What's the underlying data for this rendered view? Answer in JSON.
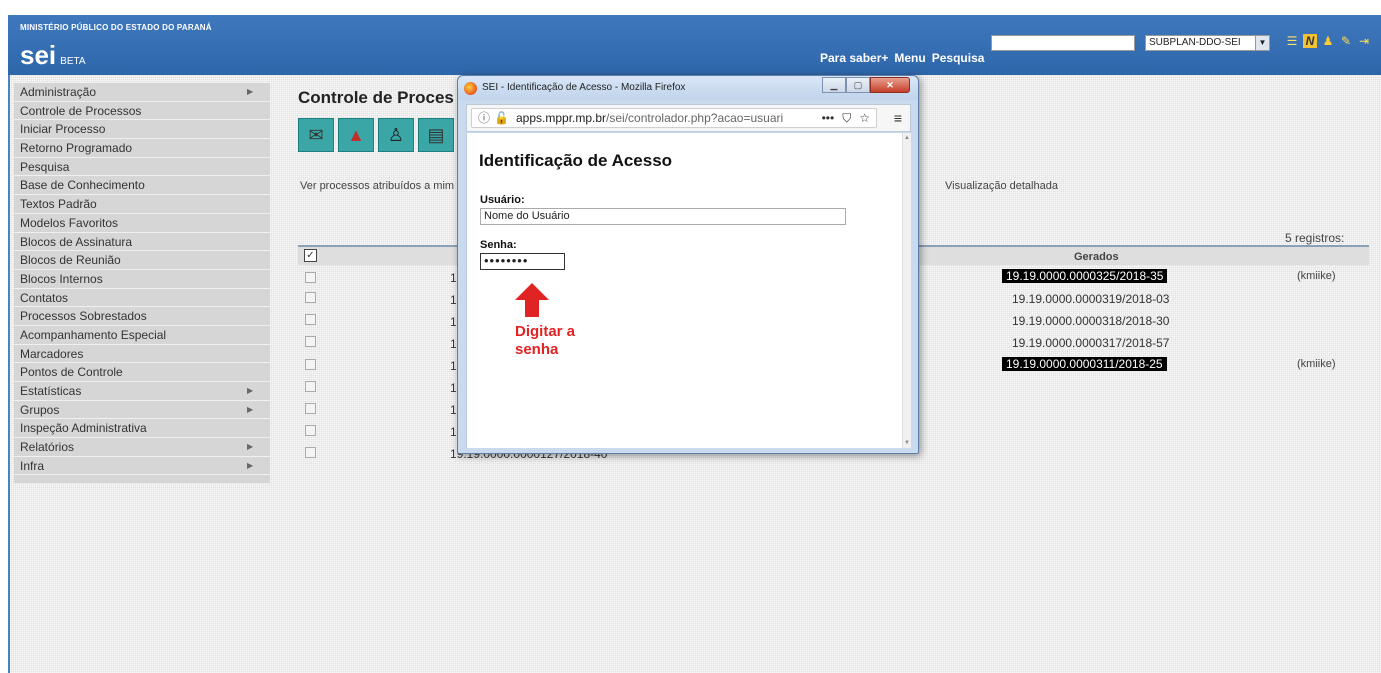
{
  "header": {
    "org_name": "MINISTÉRIO PÚBLICO DO ESTADO DO PARANÁ",
    "logo": "sei",
    "logo_beta": "BETA",
    "nav": [
      "Para saber+",
      "Menu",
      "Pesquisa"
    ],
    "search_value": "",
    "unit_selected": "SUBPLAN-DDO-SEI",
    "icons": [
      "list-icon",
      "n-icon",
      "user-icon",
      "wrench-icon",
      "exit-icon"
    ]
  },
  "sidebar": {
    "items": [
      {
        "label": "Administração",
        "submenu": true
      },
      {
        "label": "Controle de Processos",
        "submenu": false
      },
      {
        "label": "Iniciar Processo",
        "submenu": false
      },
      {
        "label": "Retorno Programado",
        "submenu": false
      },
      {
        "label": "Pesquisa",
        "submenu": false
      },
      {
        "label": "Base de Conhecimento",
        "submenu": false
      },
      {
        "label": "Textos Padrão",
        "submenu": false
      },
      {
        "label": "Modelos Favoritos",
        "submenu": false
      },
      {
        "label": "Blocos de Assinatura",
        "submenu": false
      },
      {
        "label": "Blocos de Reunião",
        "submenu": false
      },
      {
        "label": "Blocos Internos",
        "submenu": false
      },
      {
        "label": "Contatos",
        "submenu": false
      },
      {
        "label": "Processos Sobrestados",
        "submenu": false
      },
      {
        "label": "Acompanhamento Especial",
        "submenu": false
      },
      {
        "label": "Marcadores",
        "submenu": false
      },
      {
        "label": "Pontos de Controle",
        "submenu": false
      },
      {
        "label": "Estatísticas",
        "submenu": true
      },
      {
        "label": "Grupos",
        "submenu": true
      },
      {
        "label": "Inspeção Administrativa",
        "submenu": false
      },
      {
        "label": "Relatórios",
        "submenu": true
      },
      {
        "label": "Infra",
        "submenu": true
      }
    ]
  },
  "main": {
    "title": "Controle de Proces",
    "ver_link": "Ver processos atribuídos a mim",
    "detail_link": "Visualização detalhada",
    "registros": "5 registros:",
    "col_gerados": "Gerados",
    "row_fragment": "19",
    "last_row_partial": "19.19.0000.0000127/2018-40",
    "gerados": [
      {
        "number": "19.19.0000.0000325/2018-35",
        "highlighted": true,
        "user": "(kmiike)"
      },
      {
        "number": "19.19.0000.0000319/2018-03",
        "highlighted": false,
        "user": ""
      },
      {
        "number": "19.19.0000.0000318/2018-30",
        "highlighted": false,
        "user": ""
      },
      {
        "number": "19.19.0000.0000317/2018-57",
        "highlighted": false,
        "user": ""
      },
      {
        "number": "19.19.0000.0000311/2018-25",
        "highlighted": true,
        "user": "(kmiike)"
      }
    ]
  },
  "firefox": {
    "window_title": "SEI - Identificação de Acesso - Mozilla Firefox",
    "url_domain": "apps.mppr.mp.br",
    "url_rest": "/sei/controlador.php?acao=usuari",
    "page_actions": "•••",
    "dialog": {
      "heading": "Identificação de Acesso",
      "user_label": "Usuário:",
      "user_value": "Nome do Usuário",
      "password_label": "Senha:",
      "password_value": "••••••••"
    },
    "annotation": "Digitar a senha"
  },
  "colors": {
    "header_blue": "#3f78bd",
    "annotation_red": "#e02424"
  }
}
